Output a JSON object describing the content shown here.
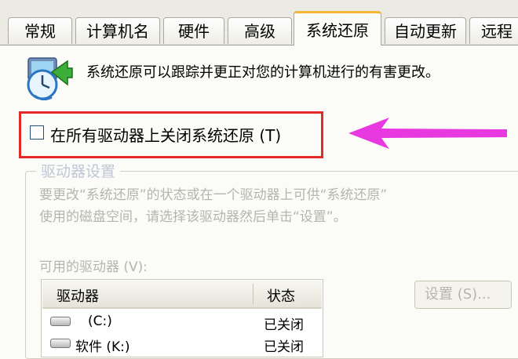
{
  "tabs": [
    {
      "label": "常规"
    },
    {
      "label": "计算机名"
    },
    {
      "label": "硬件"
    },
    {
      "label": "高级"
    },
    {
      "label": "系统还原"
    },
    {
      "label": "自动更新"
    },
    {
      "label": "远程"
    }
  ],
  "active_tab": "系统还原",
  "description": "系统还原可以跟踪并更正对您的计算机进行的有害更改。",
  "turn_off_checkbox": {
    "label": "在所有驱动器上关闭系统还原 (T)",
    "checked": false
  },
  "highlight_color": "#e22a2a",
  "arrow_color": "#e838e0",
  "drive_settings": {
    "title": "驱动器设置",
    "info_line1": "要更改“系统还原”的状态或在一个驱动器上可供“系统还原”",
    "info_line2": "使用的磁盘空间，请选择该驱动器然后单击“设置”。",
    "available_label": "可用的驱动器 (V):",
    "columns": [
      "驱动器",
      "状态"
    ],
    "rows": [
      {
        "drive": "(C:)",
        "status": "已关闭"
      },
      {
        "drive": "软件 (K:)",
        "status": "已关闭"
      }
    ],
    "settings_button": "设置 (S)..."
  }
}
